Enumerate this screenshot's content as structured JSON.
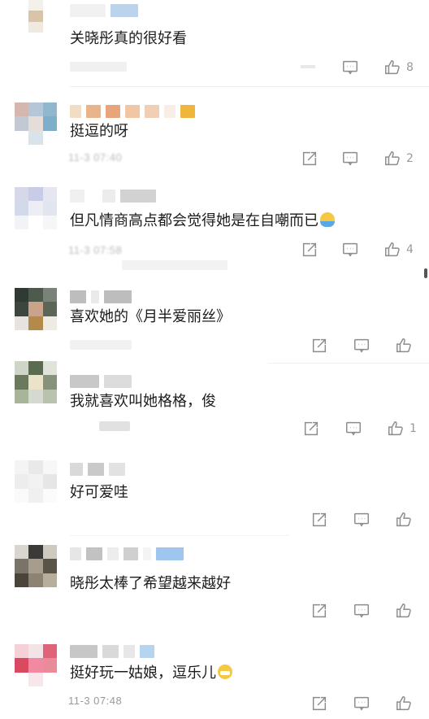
{
  "comments": [
    {
      "text": "关晓彤真的很好看",
      "time": "",
      "likes": "8"
    },
    {
      "text": "挺逗的呀",
      "time": "11-3 07:40",
      "likes": "2"
    },
    {
      "text": "但凡情商高点都会觉得她是在自嘲而已",
      "time": "11-3 07:58",
      "likes": "4",
      "emoji": "laughing-emoji"
    },
    {
      "text": "喜欢她的《月半爱丽丝》",
      "time": "",
      "likes": ""
    },
    {
      "text": "我就喜欢叫她格格，俊",
      "time": "",
      "likes": "1"
    },
    {
      "text": "好可爱哇",
      "time": "",
      "likes": ""
    },
    {
      "text": "晓彤太棒了希望越来越好",
      "time": "",
      "likes": ""
    },
    {
      "text": "挺好玩一姑娘，逗乐儿",
      "time": "11-3 07:48",
      "likes": "",
      "emoji": "grinning-emoji"
    }
  ],
  "icons": {
    "share": "share-icon",
    "reply": "comment-icon",
    "like": "thumbs-up-icon"
  },
  "colors": {
    "text": "#1c1c1c",
    "muted": "#9a9a9a",
    "emoji": "#f5c842"
  }
}
